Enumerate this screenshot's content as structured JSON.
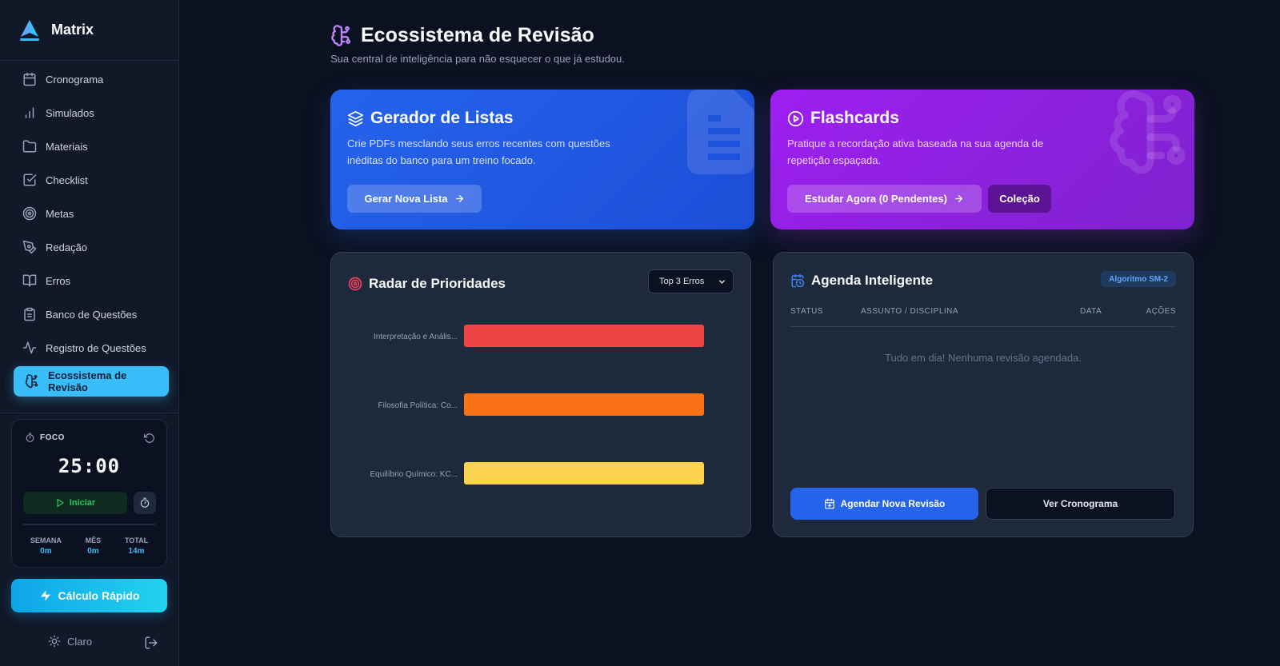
{
  "app": {
    "name": "Matrix"
  },
  "sidebar": {
    "items": [
      {
        "label": "Cronograma",
        "icon": "calendar-icon"
      },
      {
        "label": "Simulados",
        "icon": "bar-chart-icon"
      },
      {
        "label": "Materiais",
        "icon": "folder-icon"
      },
      {
        "label": "Checklist",
        "icon": "check-square-icon"
      },
      {
        "label": "Metas",
        "icon": "target-icon"
      },
      {
        "label": "Redação",
        "icon": "pen-tool-icon"
      },
      {
        "label": "Erros",
        "icon": "book-open-icon"
      },
      {
        "label": "Banco de Questões",
        "icon": "clipboard-icon"
      },
      {
        "label": "Registro de Questões",
        "icon": "activity-icon"
      },
      {
        "label": "Ecossistema de Revisão",
        "icon": "brain-icon",
        "active": true
      }
    ],
    "focus": {
      "label": "FOCO",
      "time": "25:00",
      "start_label": "Iniciar",
      "stats": [
        {
          "label": "SEMANA",
          "value": "0m"
        },
        {
          "label": "MÊS",
          "value": "0m"
        },
        {
          "label": "TOTAL",
          "value": "14m"
        }
      ]
    },
    "quick_calc_label": "Cálculo Rápido",
    "theme_label": "Claro"
  },
  "page": {
    "title": "Ecossistema de Revisão",
    "subtitle": "Sua central de inteligência para não esquecer o que já estudou."
  },
  "lists_card": {
    "title": "Gerador de Listas",
    "description": "Crie PDFs mesclando seus erros recentes com questões inéditas do banco para um treino focado.",
    "button_label": "Gerar Nova Lista"
  },
  "flashcards_card": {
    "title": "Flashcards",
    "description": "Pratique a recordação ativa baseada na sua agenda de repetição espaçada.",
    "study_label": "Estudar Agora (0 Pendentes)",
    "collection_label": "Coleção"
  },
  "radar": {
    "title": "Radar de Prioridades",
    "filter_value": "Top 3 Erros"
  },
  "chart_data": {
    "type": "bar",
    "orientation": "horizontal",
    "categories": [
      "Interpretação e Anális...",
      "Filosofia Política: Co...",
      "Equilíbrio Químico: KC..."
    ],
    "values": [
      1,
      1,
      1
    ],
    "colors": [
      "#ef4444",
      "#f97316",
      "#fcd34d"
    ],
    "xlim": [
      0,
      1
    ],
    "grid": false,
    "title": "",
    "xlabel": "",
    "ylabel": ""
  },
  "agenda": {
    "title": "Agenda Inteligente",
    "badge": "Algoritmo SM-2",
    "columns": [
      "STATUS",
      "ASSUNTO / DISCIPLINA",
      "DATA",
      "AÇÕES"
    ],
    "empty_message": "Tudo em dia! Nenhuma revisão agendada.",
    "schedule_label": "Agendar Nova Revisão",
    "calendar_label": "Ver Cronograma"
  },
  "colors": {
    "background": "#0b1120",
    "sidebar": "#111827",
    "accent": "#38bdf8",
    "blue_card": "#2563eb",
    "purple_card": "#9333ea",
    "success": "#22c55e"
  }
}
